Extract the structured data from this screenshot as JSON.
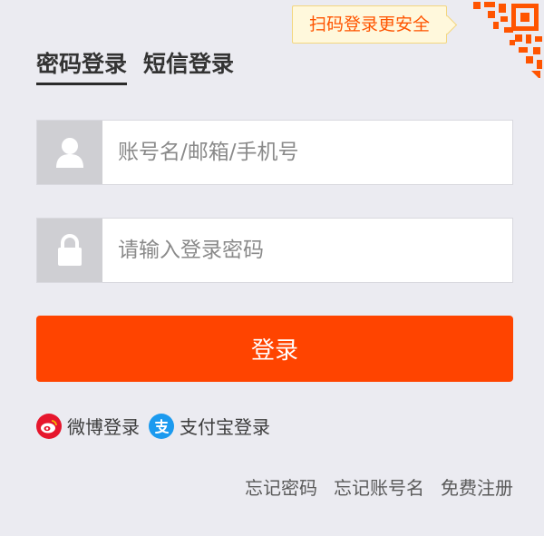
{
  "qr": {
    "tip": "扫码登录更安全"
  },
  "tabs": [
    {
      "label": "密码登录",
      "active": true
    },
    {
      "label": "短信登录",
      "active": false
    }
  ],
  "username": {
    "placeholder": "账号名/邮箱/手机号",
    "value": ""
  },
  "password": {
    "placeholder": "请输入登录密码",
    "value": ""
  },
  "login_button": "登录",
  "third_party": [
    {
      "label": "微博登录",
      "icon": "weibo-icon"
    },
    {
      "label": "支付宝登录",
      "icon": "alipay-icon"
    }
  ],
  "links": [
    "忘记密码",
    "忘记账号名",
    "免费注册"
  ],
  "colors": {
    "accent": "#ff4400",
    "tip_text": "#ff5400",
    "tip_bg": "#fff8dc",
    "background": "#ebebf1",
    "weibo": "#e6162d",
    "alipay": "#1b9aef"
  }
}
